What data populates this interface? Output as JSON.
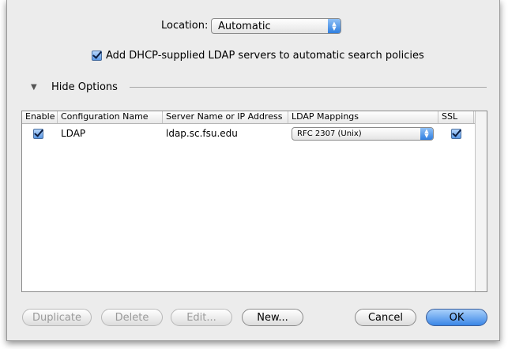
{
  "location": {
    "label": "Location:",
    "selected": "Automatic"
  },
  "dhcp_checkbox": {
    "label": "Add DHCP-supplied LDAP servers to automatic search policies",
    "checked": true
  },
  "options_toggle": {
    "label": "Hide Options"
  },
  "table": {
    "columns": [
      "Enable",
      "Configuration Name",
      "Server Name or IP Address",
      "LDAP Mappings",
      "SSL"
    ],
    "rows": [
      {
        "enabled": true,
        "name": "LDAP",
        "server": "ldap.sc.fsu.edu",
        "mapping": "RFC 2307 (Unix)",
        "ssl": true
      }
    ]
  },
  "buttons": {
    "duplicate": "Duplicate",
    "delete": "Delete",
    "edit": "Edit...",
    "new": "New...",
    "cancel": "Cancel",
    "ok": "OK"
  },
  "colors": {
    "accent": "#3a86e6",
    "sheet_bg": "#ececec"
  }
}
